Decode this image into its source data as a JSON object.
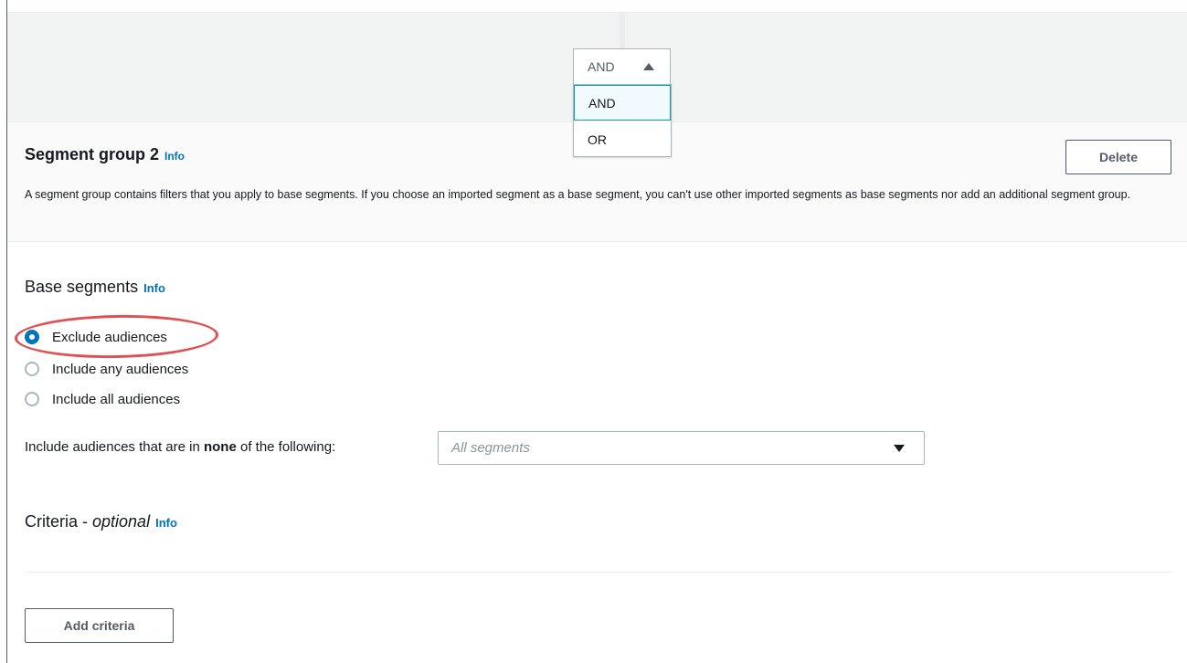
{
  "operator": {
    "current": "AND",
    "options": [
      "AND",
      "OR"
    ]
  },
  "segment_group": {
    "title": "Segment group 2",
    "info": "Info",
    "delete_label": "Delete",
    "description": "A segment group contains filters that you apply to base segments. If you choose an imported segment as a base segment, you can't use other imported segments as base segments nor add an additional segment group."
  },
  "base_segments": {
    "heading": "Base segments",
    "info": "Info",
    "options": [
      {
        "label": "Exclude audiences",
        "checked": true
      },
      {
        "label": "Include any audiences",
        "checked": false
      },
      {
        "label": "Include all audiences",
        "checked": false
      }
    ],
    "filter_label_prefix": "Include audiences that are in ",
    "filter_label_bold": "none",
    "filter_label_suffix": " of the following:",
    "select_placeholder": "All segments"
  },
  "criteria": {
    "heading_prefix": "Criteria - ",
    "heading_italic": "optional",
    "info": "Info",
    "add_label": "Add criteria"
  },
  "colors": {
    "link": "#0073bb",
    "highlight": "#e05050",
    "selected_bg": "#f1faff"
  }
}
